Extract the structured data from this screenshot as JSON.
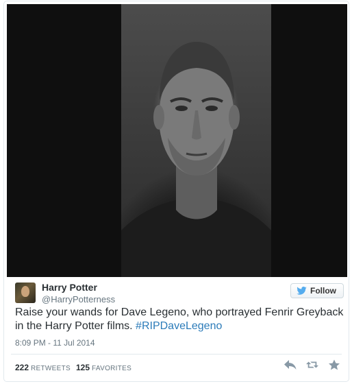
{
  "author": {
    "name": "Harry Potter",
    "handle": "@HarryPotterness",
    "follow_label": "Follow"
  },
  "tweet": {
    "text": "Raise your wands for Dave Legeno, who portrayed Fenrir Greyback in the Harry Potter films. ",
    "hashtag": "#RIPDaveLegeno",
    "timestamp": "8:09 PM - 11 Jul 2014"
  },
  "stats": {
    "retweets_count": "222",
    "retweets_label": "RETWEETS",
    "favorites_count": "125",
    "favorites_label": "FAVORITES"
  },
  "actions": {
    "reply_icon": "reply-icon",
    "retweet_icon": "retweet-icon",
    "favorite_icon": "star-icon"
  },
  "colors": {
    "link": "#2b7bb9",
    "text": "#292f33",
    "muted": "#66757f",
    "twitter_blue": "#55acee"
  }
}
